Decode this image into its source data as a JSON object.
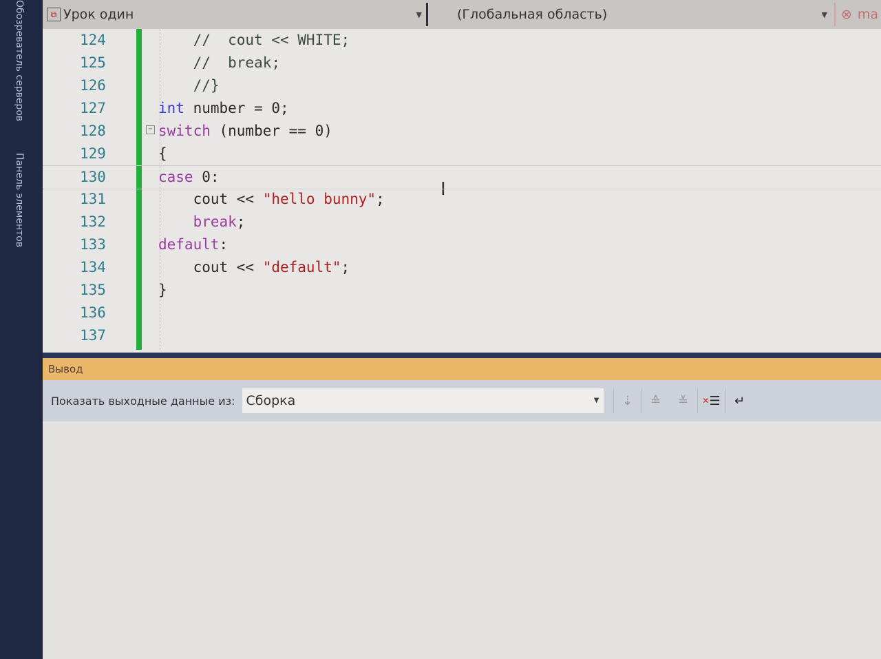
{
  "side_tabs": [
    "Обозреватель серверов",
    "Панель элементов"
  ],
  "nav": {
    "project": "Урок один",
    "scope": "(Глобальная область)",
    "member": "ma"
  },
  "code_lines": [
    {
      "n": "124",
      "tokens": [
        {
          "c": "cm",
          "t": "    //  cout << WHITE;"
        }
      ]
    },
    {
      "n": "125",
      "tokens": [
        {
          "c": "cm",
          "t": "    //  break;"
        }
      ]
    },
    {
      "n": "126",
      "tokens": [
        {
          "c": "cm",
          "t": "    //}"
        }
      ]
    },
    {
      "n": "127",
      "tokens": [
        {
          "c": "kw",
          "t": "int"
        },
        {
          "c": "",
          "t": " number = 0;"
        }
      ]
    },
    {
      "n": "128",
      "tokens": [
        {
          "c": "ctl",
          "t": "switch"
        },
        {
          "c": "",
          "t": " (number == 0)"
        }
      ]
    },
    {
      "n": "129",
      "tokens": [
        {
          "c": "",
          "t": "{"
        }
      ]
    },
    {
      "n": "130",
      "tokens": [
        {
          "c": "ctl",
          "t": "case"
        },
        {
          "c": "",
          "t": " 0:"
        }
      ]
    },
    {
      "n": "131",
      "tokens": [
        {
          "c": "",
          "t": "    cout << "
        },
        {
          "c": "str",
          "t": "\"hello bunny\""
        },
        {
          "c": "",
          "t": ";"
        }
      ]
    },
    {
      "n": "132",
      "tokens": [
        {
          "c": "",
          "t": "    "
        },
        {
          "c": "ctl",
          "t": "break"
        },
        {
          "c": "",
          "t": ";"
        }
      ]
    },
    {
      "n": "133",
      "tokens": [
        {
          "c": "ctl",
          "t": "default"
        },
        {
          "c": "",
          "t": ":"
        }
      ]
    },
    {
      "n": "134",
      "tokens": [
        {
          "c": "",
          "t": "    cout << "
        },
        {
          "c": "str",
          "t": "\"default\""
        },
        {
          "c": "",
          "t": ";"
        }
      ]
    },
    {
      "n": "135",
      "tokens": [
        {
          "c": "",
          "t": "}"
        }
      ]
    },
    {
      "n": "136",
      "tokens": []
    },
    {
      "n": "137",
      "tokens": []
    }
  ],
  "output": {
    "title": "Вывод",
    "show_label": "Показать выходные данные из:",
    "source": "Сборка"
  },
  "colors": {
    "accent": "#ebb86a",
    "change_bar": "#22b03a",
    "sidebar": "#1e2842"
  }
}
